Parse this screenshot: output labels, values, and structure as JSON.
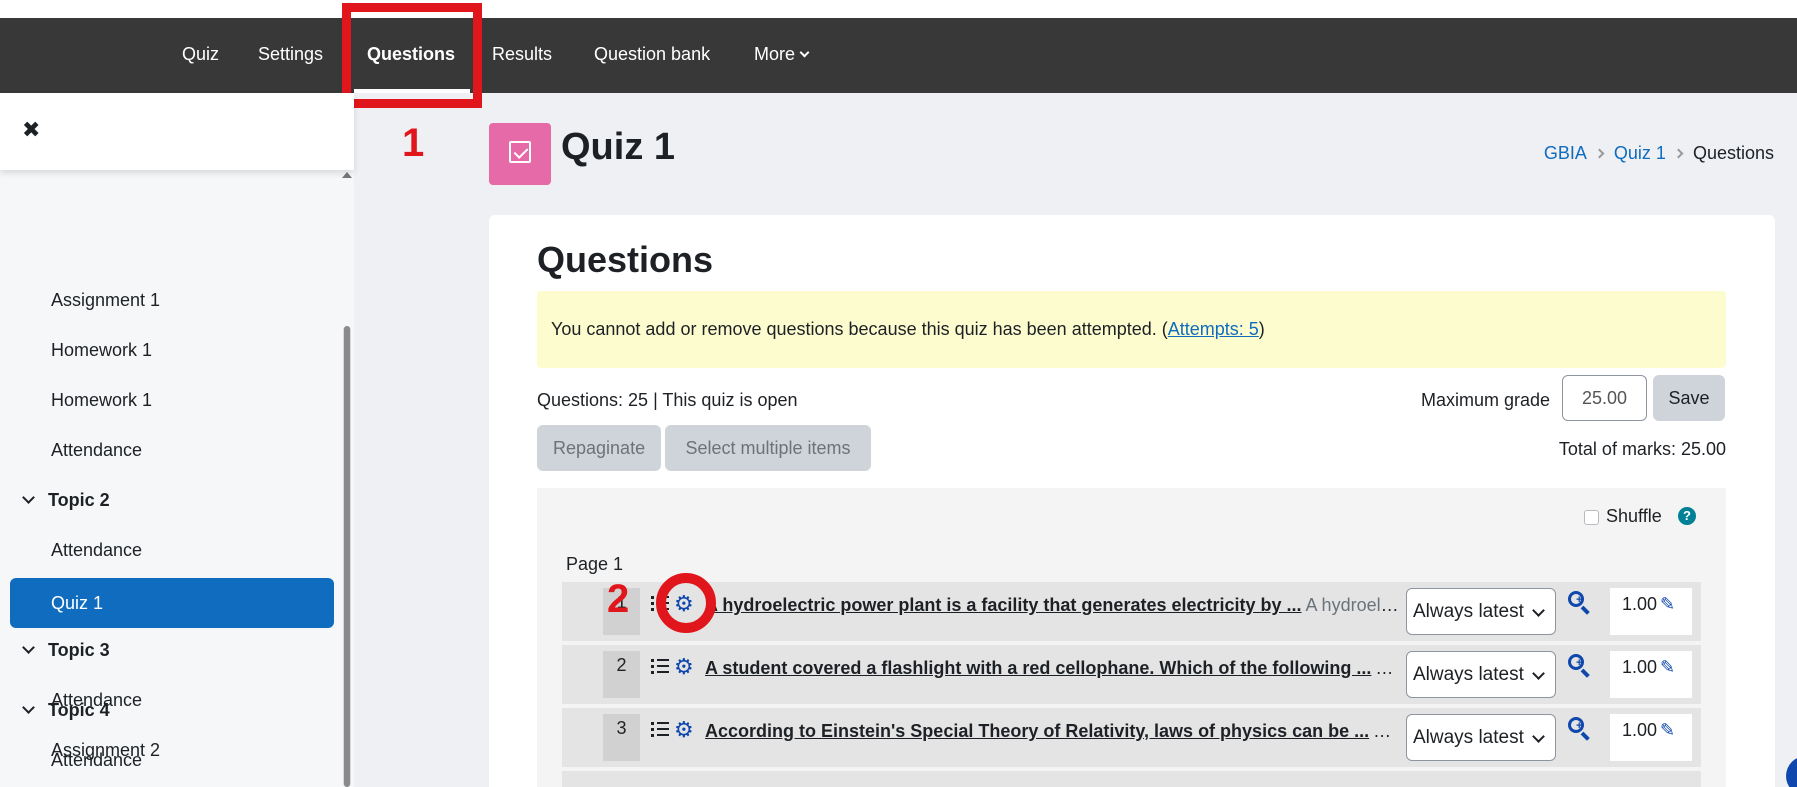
{
  "nav": {
    "items": [
      {
        "label": "Quiz",
        "active": false
      },
      {
        "label": "Settings",
        "active": false
      },
      {
        "label": "Questions",
        "active": true
      },
      {
        "label": "Results",
        "active": false
      },
      {
        "label": "Question bank",
        "active": false
      },
      {
        "label": "More",
        "active": false
      }
    ]
  },
  "drawer": {
    "close_icon": "close-icon",
    "items": [
      {
        "type": "item",
        "label": "Assignment 1"
      },
      {
        "type": "item",
        "label": "Homework 1"
      },
      {
        "type": "item",
        "label": "Homework 1"
      },
      {
        "type": "item",
        "label": "Attendance"
      },
      {
        "type": "topic",
        "label": "Topic 2"
      },
      {
        "type": "item",
        "label": "Attendance"
      },
      {
        "type": "active",
        "label": "Quiz 1"
      },
      {
        "type": "topic",
        "label": "Topic 3"
      },
      {
        "type": "item",
        "label": "Attendance"
      },
      {
        "type": "item",
        "label": "Assignment 2"
      },
      {
        "type": "topic",
        "label": "Topic 4"
      },
      {
        "type": "item",
        "label": "Attendance"
      }
    ]
  },
  "header": {
    "title": "Quiz 1",
    "icon": "quiz-checkbox-icon",
    "icon_color": "#e66aa8",
    "breadcrumb": [
      "GBIA",
      "Quiz 1",
      "Questions"
    ]
  },
  "main": {
    "section_title": "Questions",
    "alert": {
      "text": "You cannot add or remove questions because this quiz has been attempted. (",
      "link": "Attempts: 5",
      "text_end": ")"
    },
    "status": "Questions: 25 | This quiz is open",
    "max_grade_label": "Maximum grade",
    "max_grade_value": "25.00",
    "save_label": "Save",
    "repaginate_label": "Repaginate",
    "select_multiple_label": "Select multiple items",
    "total_marks": "Total of marks: 25.00",
    "shuffle_label": "Shuffle",
    "help_glyph": "?",
    "page_label": "Page 1",
    "questions": [
      {
        "num": "1",
        "title": "A hydroelectric power plant is a facility that generates electricity by ...",
        "desc": "A hydroelectric power plant is a facility that generates electricity by",
        "version": "Always latest",
        "mark": "1.00"
      },
      {
        "num": "2",
        "title": "A student covered a flashlight with a red cellophane. Which of the following ...",
        "desc": "A student covered a flashlight with a red cellophane.",
        "version": "Always latest",
        "mark": "1.00"
      },
      {
        "num": "3",
        "title": "According to Einstein's Special Theory of Relativity, laws of physics can be ...",
        "desc": "According to Einstein's Special Theory of Relativity",
        "version": "Always latest",
        "mark": "1.00"
      }
    ]
  },
  "annotations": {
    "label_1": "1",
    "label_2": "2",
    "color": "#e0161c"
  },
  "colors": {
    "navbar": "#383838",
    "accent": "#0f6cbf",
    "alert_bg": "#fdfcce",
    "icon_blue": "#0f47ad"
  }
}
